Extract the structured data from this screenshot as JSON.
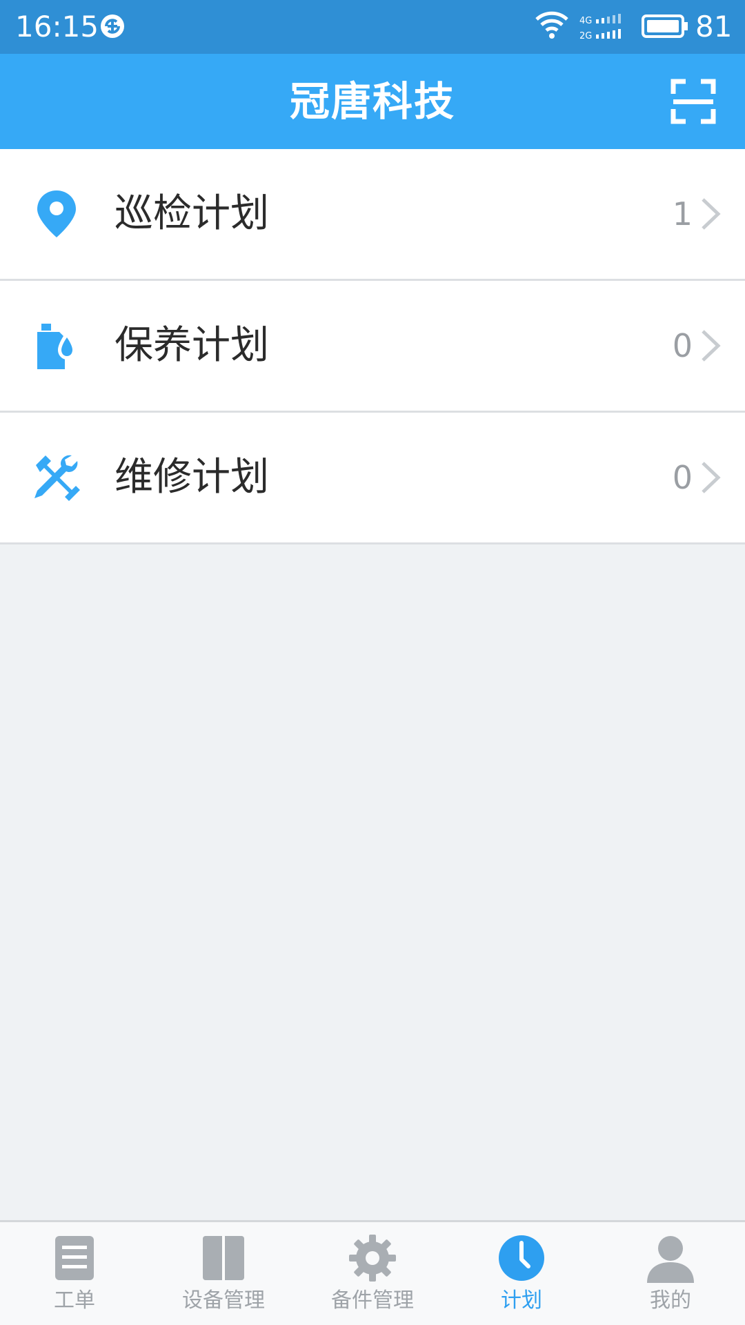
{
  "status_bar": {
    "time": "16:15",
    "battery_level": "81",
    "icons": [
      "sync-icon",
      "wifi-icon",
      "signal-icon",
      "battery-icon"
    ]
  },
  "header": {
    "title": "冠唐科技",
    "scan_icon": "scan-icon"
  },
  "menu": {
    "items": [
      {
        "label": "巡检计划",
        "count": "1",
        "icon": "location-pin-icon"
      },
      {
        "label": "保养计划",
        "count": "0",
        "icon": "oil-drop-icon"
      },
      {
        "label": "维修计划",
        "count": "0",
        "icon": "tools-icon"
      }
    ]
  },
  "bottom_nav": {
    "tabs": [
      {
        "label": "工单",
        "icon": "document-list-icon",
        "active": false
      },
      {
        "label": "设备管理",
        "icon": "device-panel-icon",
        "active": false
      },
      {
        "label": "备件管理",
        "icon": "gear-icon",
        "active": false
      },
      {
        "label": "计划",
        "icon": "clock-icon",
        "active": true
      },
      {
        "label": "我的",
        "icon": "user-icon",
        "active": false
      }
    ]
  },
  "colors": {
    "status_bar": "#2f8fd5",
    "header": "#36a9f6",
    "accent": "#2e9ff0",
    "background": "#eff2f4",
    "inactive": "#9ea3a8"
  }
}
